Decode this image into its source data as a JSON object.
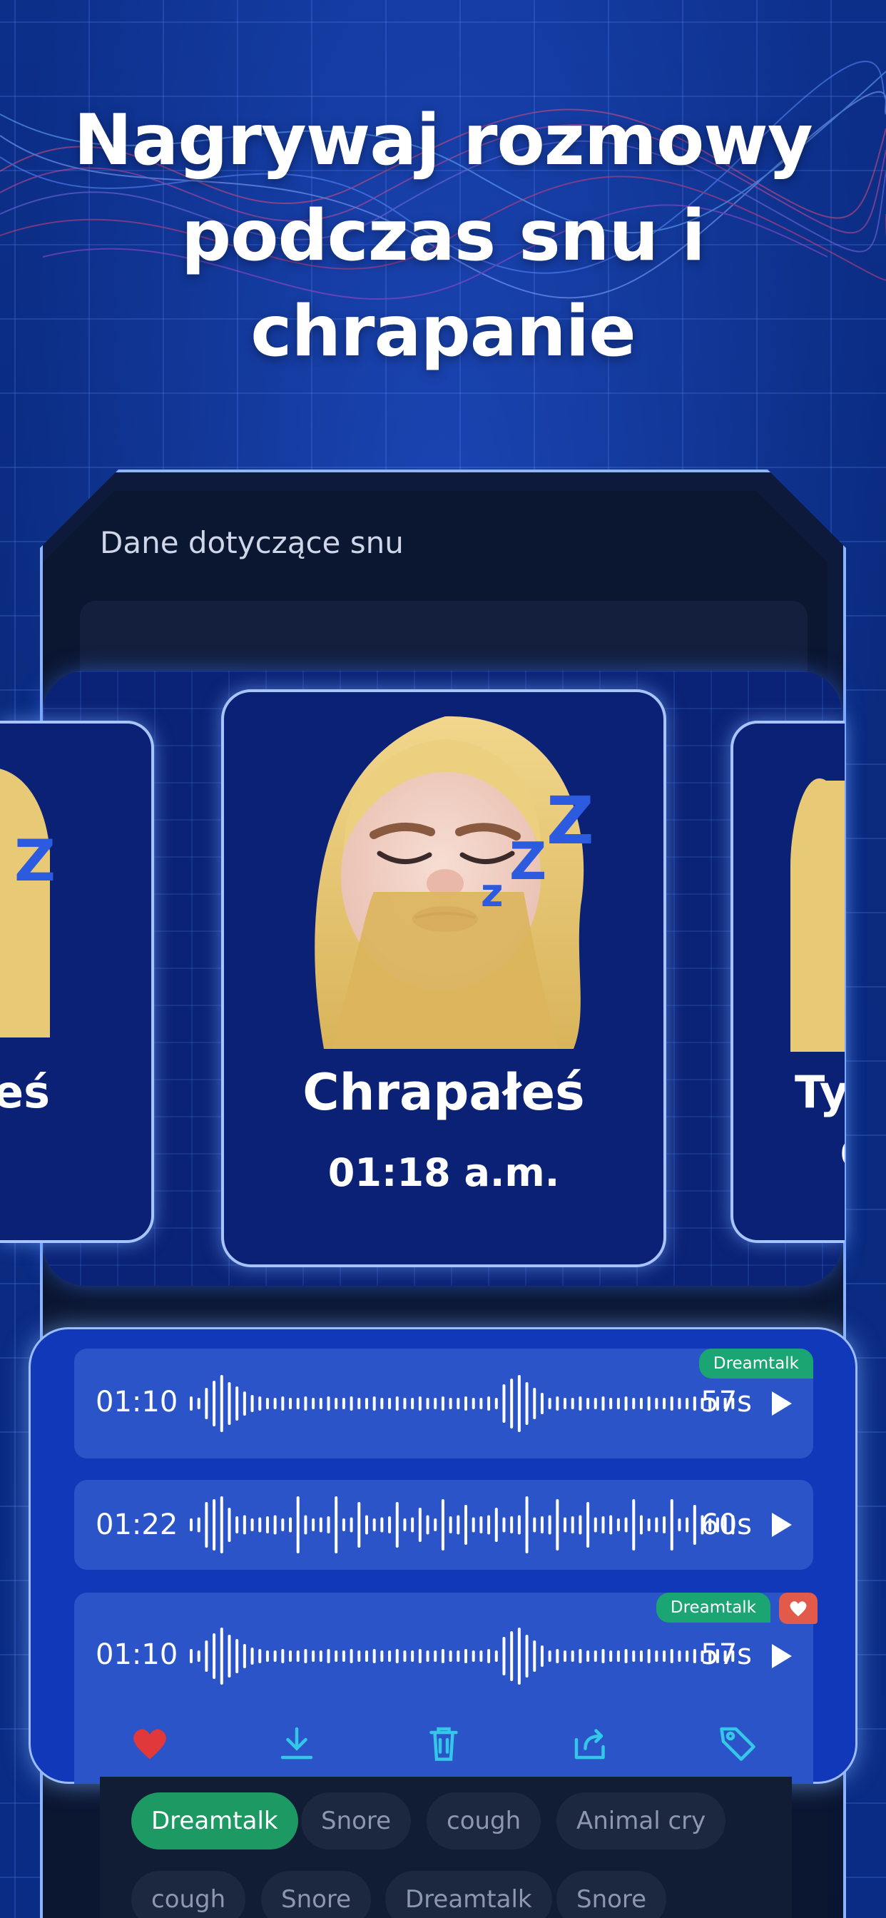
{
  "headline": {
    "line1": "Nagrywaj rozmowy",
    "line2": "podczas snu i",
    "line3": "chrapanie"
  },
  "screen": {
    "section_title": "Dane dotyczące snu"
  },
  "carousel": {
    "left_card_label_fragment": "eś",
    "main_card": {
      "label": "Chrapałeś",
      "time": "01:18 a.m."
    },
    "right_card_label_fragment": "Ty",
    "right_card_time_fragment": "0"
  },
  "recordings": [
    {
      "time": "01:10",
      "duration": "57s",
      "tag": "Dreamtalk",
      "favorite": false
    },
    {
      "time": "01:22",
      "duration": "60s",
      "tag": "",
      "favorite": false
    },
    {
      "time": "01:10",
      "duration": "57s",
      "tag": "Dreamtalk",
      "favorite": true
    }
  ],
  "actions": [
    "heart-icon",
    "download-icon",
    "trash-icon",
    "share-icon",
    "tag-icon"
  ],
  "tag_chips": {
    "row1": [
      "Dreamtalk",
      "Snore",
      "cough",
      "Animal cry"
    ],
    "row2": [
      "cough",
      "Snore",
      "Dreamtalk",
      "Snore"
    ],
    "active": "Dreamtalk"
  },
  "colors": {
    "background": "#0b2a7e",
    "panel": "#1038b8",
    "recording_row": "#2a54c8",
    "tag_green": "#1aa572",
    "heart_red": "#e0383b",
    "accent_cyan": "#35c7e8"
  }
}
